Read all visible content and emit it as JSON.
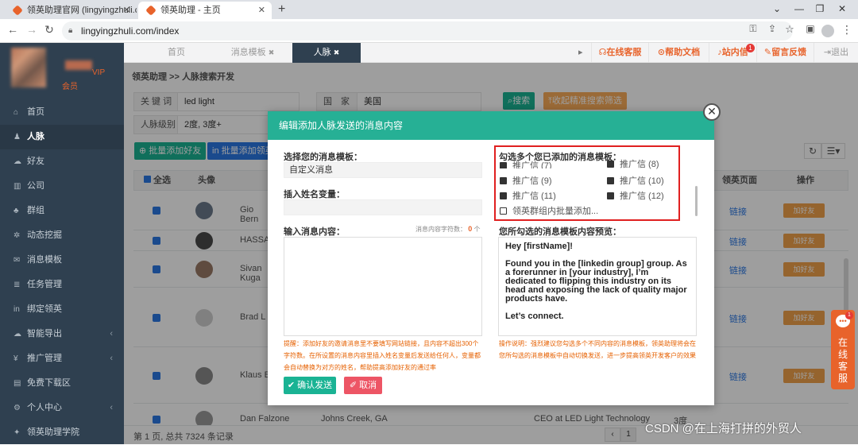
{
  "browser": {
    "tabs": [
      {
        "title": "领英助理官网 (lingyingzhuli.co"
      },
      {
        "title": "领英助理 - 主页"
      }
    ],
    "url": "lingyingzhuli.com/index"
  },
  "sidebar": {
    "user_level": "VIP",
    "user_role": "会员",
    "items": [
      {
        "label": "首页",
        "icon": "home-icon"
      },
      {
        "label": "人脉",
        "icon": "users-icon",
        "active": true
      },
      {
        "label": "好友",
        "icon": "chat-icon"
      },
      {
        "label": "公司",
        "icon": "building-icon"
      },
      {
        "label": "群组",
        "icon": "group-icon"
      },
      {
        "label": "动态挖掘",
        "icon": "gear-icon"
      },
      {
        "label": "消息模板",
        "icon": "mail-icon"
      },
      {
        "label": "任务管理",
        "icon": "list-icon"
      },
      {
        "label": "绑定领英",
        "icon": "linkedin-icon"
      },
      {
        "label": "智能导出",
        "icon": "cloud-icon",
        "arrow": "‹"
      },
      {
        "label": "推广管理",
        "icon": "yen-icon",
        "arrow": "‹"
      },
      {
        "label": "免费下载区",
        "icon": "file-icon"
      },
      {
        "label": "个人中心",
        "icon": "cog-icon",
        "arrow": "‹"
      },
      {
        "label": "领英助理学院",
        "icon": "star-icon"
      }
    ]
  },
  "topnav": {
    "page_tabs": [
      "首页",
      "消息模板",
      "人脉"
    ],
    "links": [
      "在线客服",
      "帮助文档",
      "站内信",
      "留言反馈",
      "退出"
    ],
    "message_badge": "1"
  },
  "breadcrumb": "领英助理 >> 人脉搜索开发",
  "search": {
    "keyword_label": "关 键 词",
    "keyword_value": "led light",
    "country_label": "国　家",
    "country_value": "美国",
    "level_label": "人脉级别",
    "level_value": "2度, 3度+",
    "search_btn": "搜索",
    "collapse_btn": "收起精准搜索筛选"
  },
  "actions": {
    "batch_add_friend": "批量添加好友",
    "batch_add_linkedin": "批量添加领英"
  },
  "table": {
    "headers": [
      "全选",
      "头像",
      "领英页面",
      "操作"
    ],
    "rows": [
      {
        "name": "Gio\nBern",
        "link": "链接",
        "op": "加好友"
      },
      {
        "name": "HASSA",
        "link": "链接",
        "op": "加好友"
      },
      {
        "name": "Sivan\nKuga",
        "link": "链接",
        "op": "加好友"
      },
      {
        "name": "Brad L",
        "link": "链接",
        "op": "加好友"
      },
      {
        "name": "Klaus B",
        "link": "链接",
        "op": "加好友"
      },
      {
        "name": "Dan Falzone",
        "location": "Johns Creek, GA",
        "title": "CEO at LED Light Technology",
        "degree": "3度"
      }
    ],
    "footer": "第 1 页, 总共 7324 条记录"
  },
  "modal": {
    "title": "编辑添加人脉发送的消息内容",
    "template_label": "选择您的消息模板：",
    "template_value": "自定义消息",
    "var_label": "插入姓名变量：",
    "content_label": "输入消息内容：",
    "char_count_label": "消息内容字符数：",
    "char_count": "0",
    "char_unit": "个",
    "multi_label": "勾选多个您已添加的消息模板：",
    "templates": [
      "推广信 (7)",
      "推广信 (8)",
      "推广信 (9)",
      "推广信 (10)",
      "推广信 (11)",
      "推广信 (12)"
    ],
    "group_template": "领英群组内批量添加...",
    "preview_label": "您所勾选的消息模板内容预览：",
    "preview_text": "Hey [firstName]!\n\nFound you in the [linkedin group] group. As a forerunner in [your industry], I’m dedicated to flipping this industry on its head and exposing the lack of quality major products have.\n\nLet’s connect.",
    "left_note": "提醒：添加好友的邀请消息里不要填写网站链接，且内容不超出300个字符数。在所设置的消息内容里插入姓名变量后发送给任何人，变量都会自动替换为对方的姓名，帮助提高添加好友的通过率",
    "right_note": "操作说明：强烈建议您勾选多个不同内容的消息模板，领英助理将会在您所勾选的消息模板中自动切换发送，进一步提高领英开发客户的效果",
    "confirm_btn": "确认发送",
    "cancel_btn": "取消"
  },
  "chat_float": {
    "label": "在线客服",
    "badge": "1"
  },
  "watermark": "CSDN @在上海打拼的外贸人"
}
